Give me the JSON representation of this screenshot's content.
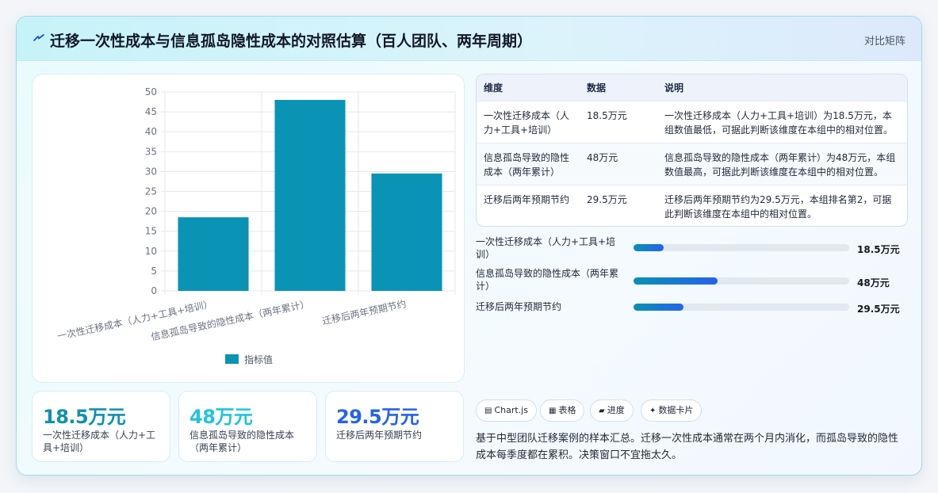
{
  "header": {
    "title": "迁移一次性成本与信息孤岛隐性成本的对照估算（百人团队、两年周期）",
    "tag": "对比矩阵",
    "icon": "lightning-icon"
  },
  "chart_data": {
    "type": "bar",
    "categories": [
      "一次性迁移成本（人力+工具+培训）",
      "信息孤岛导致的隐性成本（两年累计）",
      "迁移后两年预期节约"
    ],
    "series": [
      {
        "name": "指标值",
        "values": [
          18.5,
          48,
          29.5
        ],
        "color": "#0a93b4"
      }
    ],
    "ylim": [
      0,
      50
    ],
    "yticks": [
      "0",
      "5",
      "10",
      "15",
      "20",
      "25",
      "30",
      "35",
      "40",
      "45",
      "50"
    ],
    "grid": true,
    "legend": "bottom"
  },
  "kpis": [
    {
      "value": "18.5万元",
      "label": "一次性迁移成本（人力+工具+培训）",
      "color": "#0e91b0"
    },
    {
      "value": "48万元",
      "label": "信息孤岛导致的隐性成本（两年累计）",
      "color": "#22c3df"
    },
    {
      "value": "29.5万元",
      "label": "迁移后两年预期节约",
      "color": "#2563eb"
    }
  ],
  "table": {
    "headers": [
      "维度",
      "数据",
      "说明"
    ],
    "rows": [
      [
        "一次性迁移成本（人力+工具+培训）",
        "18.5万元",
        "一次性迁移成本（人力+工具+培训）为18.5万元，本组数值最低，可据此判断该维度在本组中的相对位置。"
      ],
      [
        "信息孤岛导致的隐性成本（两年累计）",
        "48万元",
        "信息孤岛导致的隐性成本（两年累计）为48万元，本组数值最高，可据此判断该维度在本组中的相对位置。"
      ],
      [
        "迁移后两年预期节约",
        "29.5万元",
        "迁移后两年预期节约为29.5万元，本组排名第2，可据此判断该维度在本组中的相对位置。"
      ]
    ]
  },
  "progress": [
    {
      "label": "一次性迁移成本（人力+工具+培训）",
      "value": "18.5万元",
      "fraction": 0.14
    },
    {
      "label": "信息孤岛导致的隐性成本（两年累计）",
      "value": "48万元",
      "fraction": 0.39
    },
    {
      "label": "迁移后两年预期节约",
      "value": "29.5万元",
      "fraction": 0.23
    }
  ],
  "chips": [
    {
      "icon": "chart-icon",
      "glyph": "▤",
      "label": "Chart.js"
    },
    {
      "icon": "table-icon",
      "glyph": "▦",
      "label": "表格"
    },
    {
      "icon": "progress-icon",
      "glyph": "▰",
      "label": "进度"
    },
    {
      "icon": "sparkle-icon",
      "glyph": "✦",
      "label": "数据卡片"
    }
  ],
  "summary": "基于中型团队迁移案例的样本汇总。迁移一次性成本通常在两个月内消化，而孤岛导致的隐性成本每季度都在累积。决策窗口不宜拖太久。"
}
